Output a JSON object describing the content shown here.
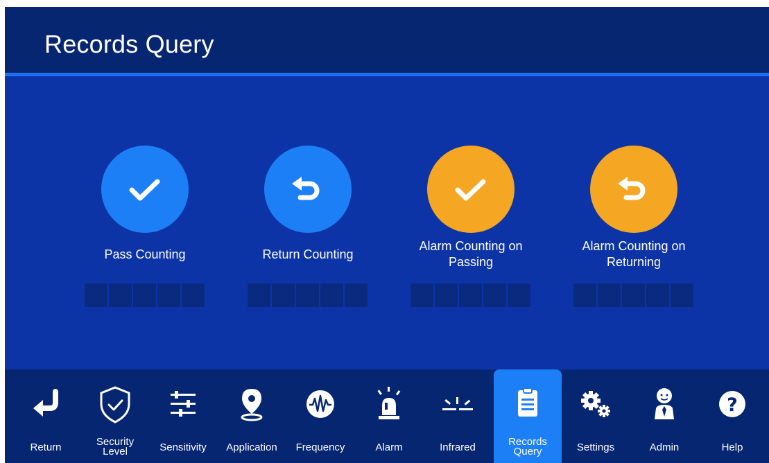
{
  "header": {
    "title": "Records Query"
  },
  "counters": [
    {
      "label": "Pass Counting",
      "icon": "checkmark-icon",
      "color": "#1d7ff5"
    },
    {
      "label": "Return Counting",
      "icon": "undo-arrow-icon",
      "color": "#1d7ff5"
    },
    {
      "label": "Alarm Counting on Passing",
      "icon": "checkmark-icon",
      "color": "#f5a623"
    },
    {
      "label": "Alarm Counting on Returning",
      "icon": "undo-arrow-icon",
      "color": "#f5a623"
    }
  ],
  "toolbar": {
    "items": [
      {
        "label": "Return",
        "icon": "return-arrow-icon"
      },
      {
        "label": "Security Level",
        "icon": "shield-check-icon"
      },
      {
        "label": "Sensitivity",
        "icon": "sliders-icon"
      },
      {
        "label": "Application",
        "icon": "location-pin-icon"
      },
      {
        "label": "Frequency",
        "icon": "waveform-icon"
      },
      {
        "label": "Alarm",
        "icon": "alarm-light-icon"
      },
      {
        "label": "Infrared",
        "icon": "infrared-icon"
      },
      {
        "label": "Records Query",
        "icon": "clipboard-icon",
        "active": true
      },
      {
        "label": "Settings",
        "icon": "gears-icon"
      },
      {
        "label": "Admin",
        "icon": "admin-person-icon"
      },
      {
        "label": "Help",
        "icon": "help-icon"
      }
    ]
  },
  "colors": {
    "background": "#0c34a6",
    "header": "#062672",
    "accent_blue": "#1d7ff5",
    "accent_orange": "#f5a623",
    "digit_cell": "#0a2a80"
  }
}
